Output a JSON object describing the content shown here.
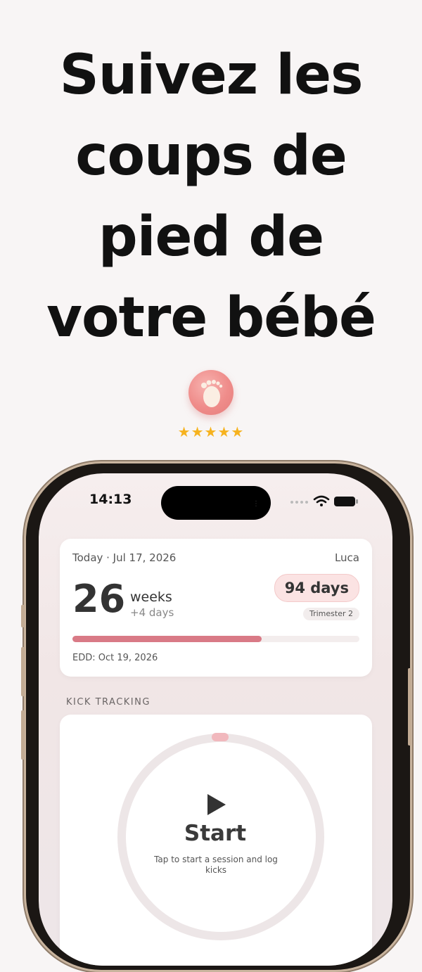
{
  "headline": {
    "lines": [
      "Suivez les",
      "coups de",
      "pied de",
      "votre bébé"
    ]
  },
  "app_icon": "baby-foot-icon",
  "rating": {
    "stars": 5,
    "display": "★★★★★"
  },
  "phone": {
    "status_bar": {
      "time": "14:13",
      "icons": [
        "signal-dots-icon",
        "wifi-icon",
        "battery-icon"
      ]
    },
    "pregnancy_card": {
      "date": "Today · Jul 17, 2026",
      "user": "Luca",
      "weeks_number": "26",
      "weeks_label": "weeks",
      "extra_days": "+4 days",
      "days_remaining": "94 days",
      "trimester": "Trimester 2",
      "progress": 0.66,
      "edd": "EDD: Oct 19, 2026"
    },
    "kick_tracking": {
      "section_title": "KICK TRACKING",
      "start_label": "Start",
      "hint": "Tap to start a session and log kicks"
    }
  },
  "colors": {
    "accent": "#d97a86",
    "pill_bg": "#fbe3e3",
    "star": "#f6b21e",
    "background": "#f8f5f5"
  }
}
